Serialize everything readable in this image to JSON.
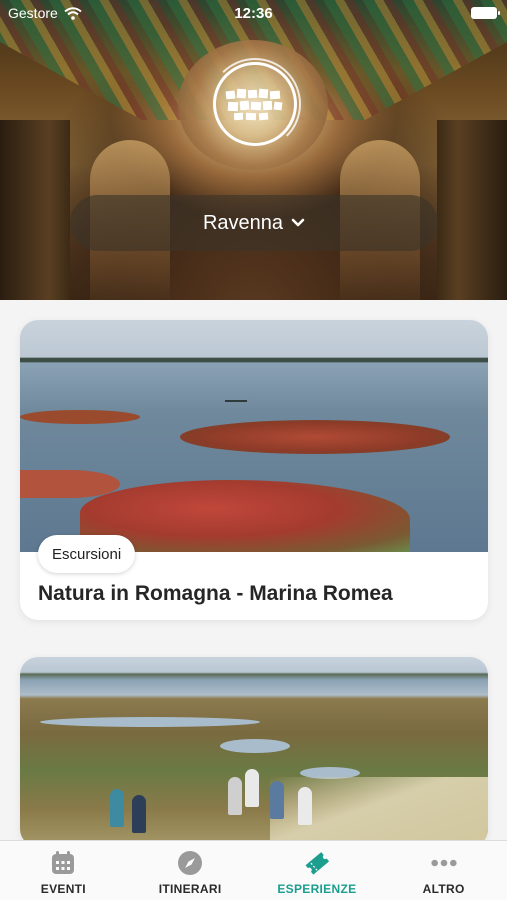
{
  "status_bar": {
    "carrier": "Gestore",
    "time": "12:36"
  },
  "header": {
    "city": "Ravenna"
  },
  "cards": [
    {
      "category": "Escursioni",
      "title": "Natura in Romagna - Marina Romea"
    },
    {
      "category": "",
      "title": ""
    }
  ],
  "tabbar": {
    "items": [
      {
        "label": "EVENTI",
        "icon": "calendar-icon"
      },
      {
        "label": "ITINERARI",
        "icon": "compass-icon"
      },
      {
        "label": "ESPERIENZE",
        "icon": "ticket-icon",
        "active": true
      },
      {
        "label": "ALTRO",
        "icon": "more-icon"
      }
    ]
  },
  "colors": {
    "accent": "#1b9e8e",
    "inactive_icon": "#9a9a9a"
  }
}
